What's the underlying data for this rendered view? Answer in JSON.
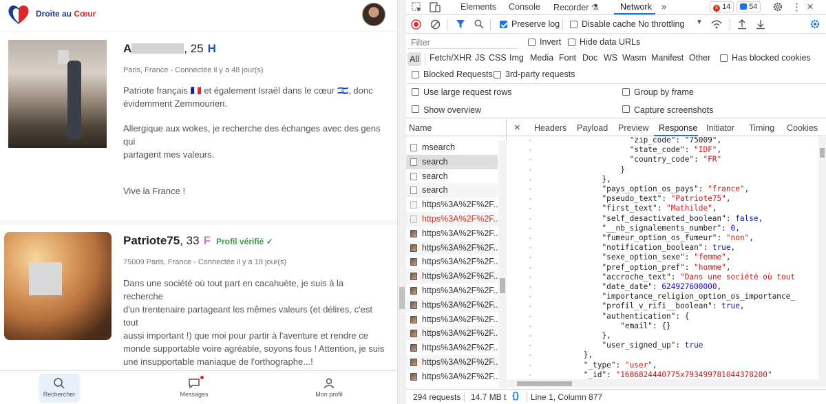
{
  "app": {
    "brand": {
      "part1": "Droite au ",
      "part2": "Cœur"
    },
    "profiles": [
      {
        "name_initial": "A",
        "age_suffix": ", 25",
        "gender": "H",
        "meta": "Paris, France - Connectée il y a 48 jour(s)",
        "desc_lines": [
          "Patriote français 🇨🇵 et également Israël dans le cœur 🇮🇱, donc",
          "évidemment Zemmourien.",
          "",
          "Allergique aux wokes, je recherche des échanges avec des gens qui",
          "partagent mes valeurs.",
          "",
          "",
          "Vive la France !"
        ]
      },
      {
        "name": "Patriote75",
        "age_suffix": ", 33",
        "gender": "F",
        "verified": "Profil vérifié ✓",
        "meta": "75009 Paris, France - Connectée il y a 18 jour(s)",
        "desc_lines": [
          "Dans une société où tout part en cacahuète, je suis à la recherche",
          "d'un trentenaire partageant les mêmes valeurs (et délires, c'est tout",
          "aussi important !) que moi pour partir à l'aventure et rendre ce",
          "monde supportable voire agréable, soyons fous ! Attention, je suis",
          "une insupportable maniaque de l'orthographe...!"
        ]
      }
    ],
    "nav": {
      "search": "Rechercher",
      "messages": "Messages",
      "profile": "Mon profil"
    }
  },
  "devtools": {
    "tabs": {
      "elements": "Elements",
      "console": "Console",
      "recorder": "Recorder ⚗",
      "network": "Network",
      "more": "»"
    },
    "errors": "14",
    "messages": "54",
    "toolbar": {
      "preserve_log": "Preserve log",
      "disable_cache": "Disable cache",
      "throttling": "No throttling"
    },
    "filter": {
      "placeholder": "Filter",
      "invert": "Invert",
      "hide_data_urls": "Hide data URLs"
    },
    "types": [
      "All",
      "Fetch/XHR",
      "JS",
      "CSS",
      "Img",
      "Media",
      "Font",
      "Doc",
      "WS",
      "Wasm",
      "Manifest",
      "Other"
    ],
    "has_blocked_cookies": "Has blocked cookies",
    "blocked_requests": "Blocked Requests",
    "third_party": "3rd-party requests",
    "large_rows": "Use large request rows",
    "group_by_frame": "Group by frame",
    "show_overview": "Show overview",
    "capture_screenshots": "Capture screenshots",
    "name_header": "Name",
    "requests": [
      {
        "name": "msearch",
        "kind": "doc"
      },
      {
        "name": "search",
        "kind": "doc",
        "selected": true
      },
      {
        "name": "search",
        "kind": "doc"
      },
      {
        "name": "search",
        "kind": "doc"
      },
      {
        "name": "https%3A%2F%2F...",
        "kind": "faint"
      },
      {
        "name": "https%3A%2F%2F...",
        "kind": "faint",
        "red": true
      },
      {
        "name": "https%3A%2F%2F...",
        "kind": "img"
      },
      {
        "name": "https%3A%2F%2F...",
        "kind": "img"
      },
      {
        "name": "https%3A%2F%2F...",
        "kind": "img"
      },
      {
        "name": "https%3A%2F%2F...",
        "kind": "img"
      },
      {
        "name": "https%3A%2F%2F...",
        "kind": "img"
      },
      {
        "name": "https%3A%2F%2F...",
        "kind": "img"
      },
      {
        "name": "https%3A%2F%2F...",
        "kind": "img"
      },
      {
        "name": "https%3A%2F%2F...",
        "kind": "img"
      },
      {
        "name": "https%3A%2F%2F...",
        "kind": "img"
      },
      {
        "name": "https%3A%2F%2F...",
        "kind": "img"
      },
      {
        "name": "https%3A%2F%2F...",
        "kind": "img"
      }
    ],
    "detail_tabs": [
      "Headers",
      "Payload",
      "Preview",
      "Response",
      "Initiator",
      "Timing",
      "Cookies"
    ],
    "code_lines": [
      [
        [
          "k",
          "                    \"zip_code\": \"75009\","
        ]
      ],
      [
        [
          "k",
          "                    \"state_code\": "
        ],
        [
          "s",
          "\"IDF\""
        ],
        [
          "k",
          ","
        ]
      ],
      [
        [
          "k",
          "                    \"country_code\": "
        ],
        [
          "s",
          "\"FR\""
        ]
      ],
      [
        [
          "k",
          "                  }"
        ]
      ],
      [
        [
          "k",
          "              },"
        ]
      ],
      [
        [
          "k",
          "              \"pays_option_os_pays\": "
        ],
        [
          "s",
          "\"france\""
        ],
        [
          "k",
          ","
        ]
      ],
      [
        [
          "k",
          "              \"pseudo_text\": "
        ],
        [
          "s",
          "\"Patriote75\""
        ],
        [
          "k",
          ","
        ]
      ],
      [
        [
          "k",
          "              \"first_text\": "
        ],
        [
          "s",
          "\"Mathilde\""
        ],
        [
          "k",
          ","
        ]
      ],
      [
        [
          "k",
          "              \"self_desactivated_boolean\": "
        ],
        [
          "b",
          "false"
        ],
        [
          "k",
          ","
        ]
      ],
      [
        [
          "k",
          "              \"__nb_signalements_number\": "
        ],
        [
          "n",
          "0"
        ],
        [
          "k",
          ","
        ]
      ],
      [
        [
          "k",
          "              \"fumeur_option_os_fumeur\": "
        ],
        [
          "s",
          "\"non\""
        ],
        [
          "k",
          ","
        ]
      ],
      [
        [
          "k",
          "              \"notification_boolean\": "
        ],
        [
          "b",
          "true"
        ],
        [
          "k",
          ","
        ]
      ],
      [
        [
          "k",
          "              \"sexe_option_sexe\": "
        ],
        [
          "s",
          "\"femme\""
        ],
        [
          "k",
          ","
        ]
      ],
      [
        [
          "k",
          "              \"pref_option_pref\": "
        ],
        [
          "s",
          "\"homme\""
        ],
        [
          "k",
          ","
        ]
      ],
      [
        [
          "k",
          "              \"accroche_text\": "
        ],
        [
          "s",
          "\"Dans une société où tout"
        ]
      ],
      [
        [
          "k",
          "              \"date_date\": "
        ],
        [
          "n",
          "624927600000"
        ],
        [
          "k",
          ","
        ]
      ],
      [
        [
          "k",
          "              \"importance_religion_option_os_importance_"
        ]
      ],
      [
        [
          "k",
          "              \"profil_v_rifi__boolean\": "
        ],
        [
          "b",
          "true"
        ],
        [
          "k",
          ","
        ]
      ],
      [
        [
          "k",
          "              \"authentication\": {"
        ]
      ],
      [
        [
          "k",
          "                  \"email\": {}"
        ]
      ],
      [
        [
          "k",
          "              },"
        ]
      ],
      [
        [
          "k",
          "              \"user_signed_up\": "
        ],
        [
          "b",
          "true"
        ]
      ],
      [
        [
          "k",
          "          },"
        ]
      ],
      [
        [
          "k",
          "          \"_type\": "
        ],
        [
          "s",
          "\"user\""
        ],
        [
          "k",
          ","
        ]
      ],
      [
        [
          "k",
          "          \"_id\": "
        ],
        [
          "s",
          "\"1686824440775x793499781044378200\""
        ]
      ],
      [
        [
          "k",
          "      },"
        ]
      ]
    ],
    "status_requests": "294 requests",
    "status_size": "14.7 MB t",
    "status_position": "Line 1, Column 877"
  }
}
